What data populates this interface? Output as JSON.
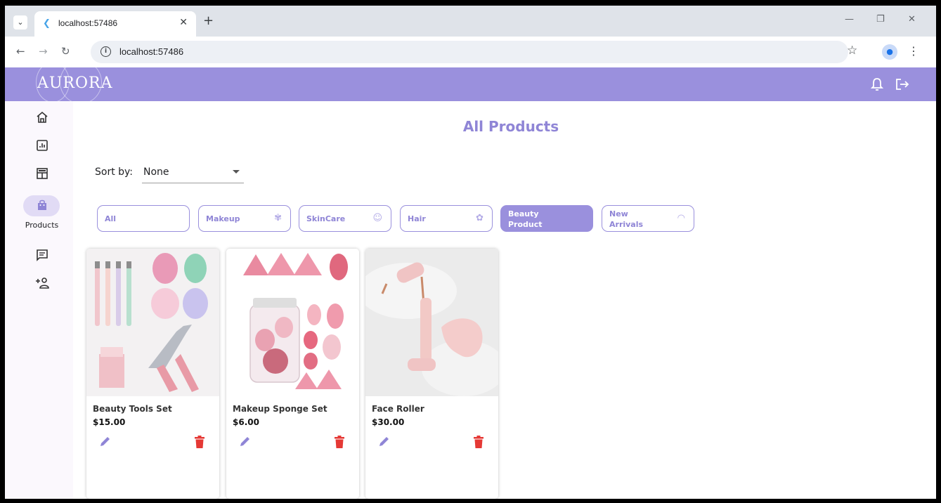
{
  "browser": {
    "tab_title": "localhost:57486",
    "url": "localhost:57486"
  },
  "app": {
    "logo": "AURORA",
    "title": "All Products"
  },
  "sidebar": {
    "active_label": "Products"
  },
  "sort": {
    "label": "Sort by:",
    "value": "None"
  },
  "filters": [
    {
      "label": "All"
    },
    {
      "label": "Makeup"
    },
    {
      "label": "SkinCare"
    },
    {
      "label": "Hair"
    },
    {
      "label": "Beauty Product",
      "active": true
    },
    {
      "label": "New Arrivals"
    }
  ],
  "products": [
    {
      "name": "Beauty Tools Set",
      "price": "$15.00"
    },
    {
      "name": "Makeup Sponge Set",
      "price": "$6.00"
    },
    {
      "name": "Face Roller",
      "price": "$30.00"
    }
  ],
  "colors": {
    "accent": "#9a90dd",
    "accent_text": "#8f85d6",
    "delete": "#e53935"
  }
}
